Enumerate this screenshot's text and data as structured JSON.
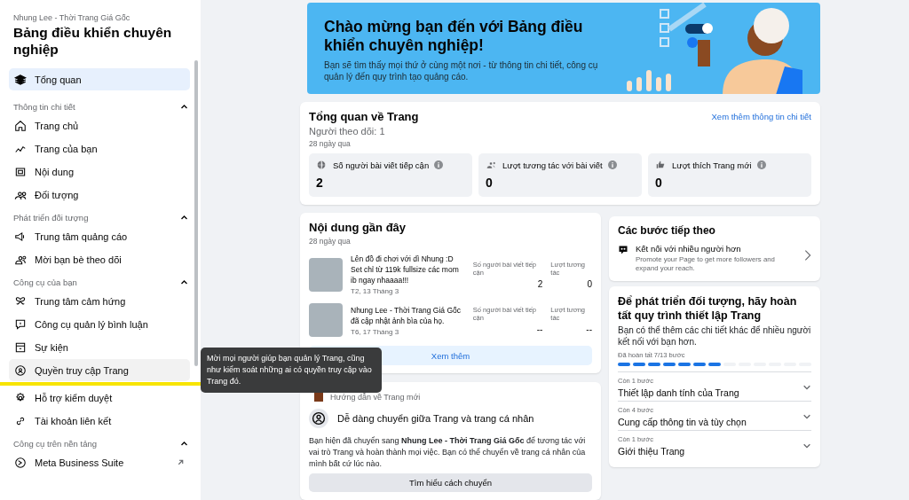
{
  "sidebar": {
    "page_name": "Nhung Lee - Thời Trang Giá Gốc",
    "title": "Bảng điều khiển chuyên nghiệp",
    "top_item": {
      "label": "Tổng quan",
      "kind": "layers",
      "selected": true
    },
    "sections": [
      {
        "title": "Thông tin chi tiết",
        "expanded": true,
        "items": [
          {
            "label": "Trang chủ",
            "kind": "home",
            "selected": false,
            "hovered": false
          },
          {
            "label": "Trang của bạn",
            "kind": "trend",
            "selected": false,
            "hovered": false
          },
          {
            "label": "Nội dung",
            "kind": "content",
            "selected": false,
            "hovered": false
          },
          {
            "label": "Đối tượng",
            "kind": "audience",
            "selected": false,
            "hovered": false
          }
        ]
      },
      {
        "title": "Phát triển đối tượng",
        "expanded": true,
        "items": [
          {
            "label": "Trung tâm quảng cáo",
            "kind": "megaphone",
            "selected": false,
            "hovered": false
          },
          {
            "label": "Mời bạn bè theo dõi",
            "kind": "people",
            "selected": false,
            "hovered": false
          }
        ]
      },
      {
        "title": "Công cụ của bạn",
        "expanded": true,
        "items": [
          {
            "label": "Trung tâm cảm hứng",
            "kind": "butterfly",
            "selected": false,
            "hovered": false
          },
          {
            "label": "Công cụ quản lý bình luận",
            "kind": "comment",
            "selected": false,
            "hovered": false
          },
          {
            "label": "Sự kiện",
            "kind": "calendar",
            "selected": false,
            "hovered": false
          },
          {
            "label": "Quyền truy cập Trang",
            "kind": "shield",
            "selected": false,
            "hovered": true,
            "highlighted": true
          },
          {
            "label": "Hỗ trợ kiểm duyệt",
            "kind": "gear",
            "selected": false,
            "hovered": false
          },
          {
            "label": "Tài khoản liên kết",
            "kind": "link",
            "selected": false,
            "hovered": false
          }
        ]
      },
      {
        "title": "Công cụ trên nền tảng",
        "expanded": true,
        "items": [
          {
            "label": "Meta Business Suite",
            "kind": "meta",
            "selected": false,
            "hovered": false,
            "external": true
          }
        ]
      }
    ]
  },
  "tooltip": "Mời mọi người giúp bạn quản lý Trang, cũng như kiểm soát những ai có quyền truy cập vào Trang đó.",
  "banner": {
    "title": "Chào mừng bạn đến với Bảng điều khiển chuyên nghiệp!",
    "text": "Bạn sẽ tìm thấy mọi thứ ở cùng một nơi - từ thông tin chi tiết, công cụ quản lý đến quy trình tạo quảng cáo."
  },
  "overview": {
    "title": "Tổng quan về Trang",
    "link": "Xem thêm thông tin chi tiết",
    "followers": "Người theo dõi: 1",
    "period": "28 ngày qua",
    "stats": [
      {
        "kind": "globe",
        "label": "Số người bài viết tiếp cận",
        "value": "2"
      },
      {
        "kind": "people",
        "label": "Lượt tương tác với bài viết",
        "value": "0"
      },
      {
        "kind": "thumb",
        "label": "Lượt thích Trang mới",
        "value": "0"
      }
    ]
  },
  "recent": {
    "title": "Nội dung gần đây",
    "period": "28 ngày qua",
    "button": "Xem thêm",
    "posts": [
      {
        "text": "Lên đồ đi chơi với dì Nhung :D Set chỉ từ 119k fullsize các mom ib ngay nhaaaa!!!",
        "date": "T2, 13 Tháng 3",
        "reach_label": "Số người bài viết tiếp cận",
        "reach": "2",
        "eng_label": "Lượt tương tác",
        "eng": "0"
      },
      {
        "text": "Nhung Lee - Thời Trang Giá Gốc đã cập nhật ảnh bìa của họ.",
        "date": "T6, 17 Tháng 3",
        "reach_label": "Số người bài viết tiếp cận",
        "reach": "--",
        "eng_label": "Lượt tương tác",
        "eng": "--"
      }
    ]
  },
  "guide": {
    "heading": "Hướng dẫn về Trang mới",
    "title": "Dễ dàng chuyển giữa Trang và trang cá nhân",
    "text": "Bạn hiện đã chuyển sang **Nhung Lee - Thời Trang Giá Gốc** để tương tác với vai trò Trang và hoàn thành mọi việc. Bạn có thể chuyển về trang cá nhân của mình bất cứ lúc nào.",
    "button": "Tìm hiểu cách chuyển"
  },
  "next_steps": {
    "title": "Các bước tiếp theo",
    "item": {
      "title": "Kết nối với nhiều người hơn",
      "text": "Promote your Page to get more followers and expand your reach."
    }
  },
  "setup": {
    "title": "Để phát triển đối tượng, hãy hoàn tất quy trình thiết lập Trang",
    "text": "Bạn có thể thêm các chi tiết khác để nhiều người kết nối với bạn hơn.",
    "progress_label": "Đã hoàn tất 7/13 bước",
    "segments": [
      {
        "done": true
      },
      {
        "done": true
      },
      {
        "done": true
      },
      {
        "done": true
      },
      {
        "done": true
      },
      {
        "done": true
      },
      {
        "done": true
      },
      {
        "done": false
      },
      {
        "done": false
      },
      {
        "done": false
      },
      {
        "done": false
      },
      {
        "done": false
      },
      {
        "done": false
      }
    ],
    "steps": [
      {
        "remaining": "Còn 1 bước",
        "title": "Thiết lập danh tính của Trang",
        "expanded": false
      },
      {
        "remaining": "Còn 4 bước",
        "title": "Cung cấp thông tin và tùy chọn",
        "expanded": false
      },
      {
        "remaining": "Còn 1 bước",
        "title": "Giới thiệu Trang",
        "expanded": false
      }
    ]
  }
}
